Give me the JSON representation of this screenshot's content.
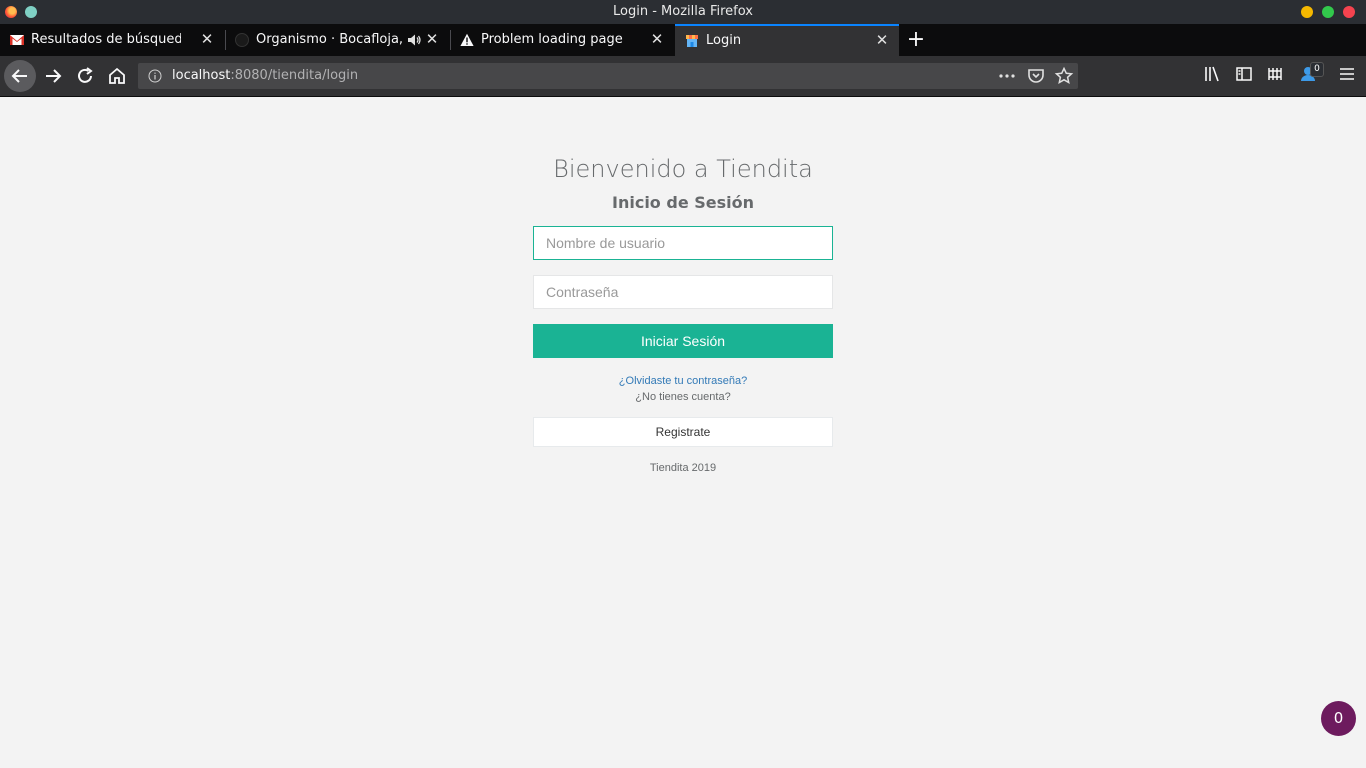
{
  "window": {
    "title": "Login - Mozilla Firefox"
  },
  "tabs": [
    {
      "label": "Resultados de búsqueda - c",
      "icon": "gmail-icon"
    },
    {
      "label": "Organismo · Bocafloja, R",
      "icon": "site-icon"
    },
    {
      "label": "Problem loading page",
      "icon": "warning-icon"
    },
    {
      "label": "Login",
      "icon": "tiendita-icon"
    }
  ],
  "navbar": {
    "url_host": "localhost",
    "url_path": ":8080/tiendita/login",
    "extension_badge": "0"
  },
  "login": {
    "welcome": "Bienvenido a Tiendita",
    "subtitle": "Inicio de Sesión",
    "username_placeholder": "Nombre de usuario",
    "password_placeholder": "Contraseña",
    "submit_label": "Iniciar Sesión",
    "forgot_link": "¿Olvidaste tu contraseña?",
    "no_account": "¿No tienes cuenta?",
    "register_label": "Registrate",
    "footer": "Tiendita 2019"
  },
  "floating_badge": "0",
  "colors": {
    "accent": "#1ab394",
    "link": "#337ab7",
    "badge": "#6d1b5e"
  }
}
